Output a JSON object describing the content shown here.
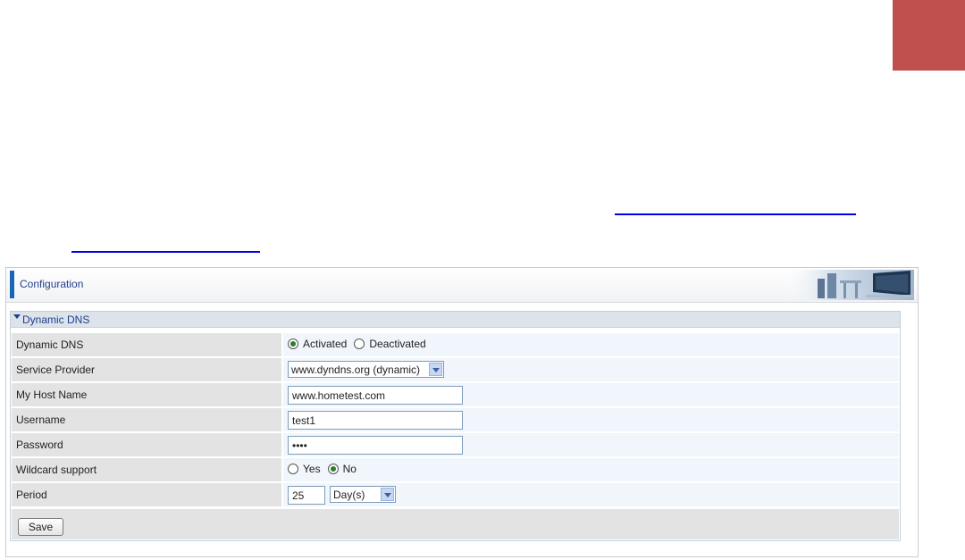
{
  "panel": {
    "title": "Configuration"
  },
  "section": {
    "title": "Dynamic DNS"
  },
  "rows": {
    "dynamic_dns": {
      "label": "Dynamic DNS",
      "options": [
        "Activated",
        "Deactivated"
      ],
      "selected": "Activated"
    },
    "service_provider": {
      "label": "Service Provider",
      "value": "www.dyndns.org (dynamic)"
    },
    "host_name": {
      "label": "My Host Name",
      "value": "www.hometest.com"
    },
    "username": {
      "label": "Username",
      "value": "test1"
    },
    "password": {
      "label": "Password",
      "value": "••••"
    },
    "wildcard": {
      "label": "Wildcard support",
      "options": [
        "Yes",
        "No"
      ],
      "selected": "No"
    },
    "period": {
      "label": "Period",
      "value": "25",
      "unit": "Day(s)"
    }
  },
  "actions": {
    "save_label": "Save"
  },
  "colors": {
    "corner_accent": "#c0504d",
    "header_accent": "#1a66b3",
    "link": "#0000ee",
    "title_text": "#1f3f8f"
  }
}
